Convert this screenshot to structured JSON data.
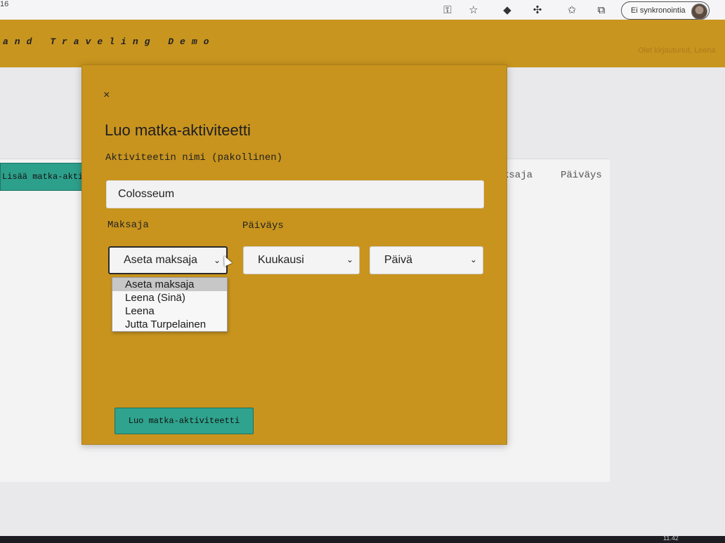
{
  "browser": {
    "tab_fragment": "16",
    "icons": [
      "key-icon",
      "favorite-add-icon",
      "extension-icon",
      "extensions-puzzle-icon",
      "favorites-icon",
      "collections-icon"
    ],
    "profile_label": "Ei synkronointia"
  },
  "header": {
    "site_title": "and Traveling Demo",
    "login_status": "Olet kirjautunut, Leena"
  },
  "background": {
    "add_button_label": "Lisää matka-akti",
    "columns": [
      "ksaja",
      "Päiväys"
    ]
  },
  "modal": {
    "close_symbol": "×",
    "title": "Luo matka-aktiviteetti",
    "name_label": "Aktiviteetin nimi (pakollinen)",
    "name_value": "Colosseum",
    "payer_label": "Maksaja",
    "date_label": "Päiväys",
    "payer_select": "Aseta maksaja",
    "month_select": "Kuukausi",
    "day_select": "Päivä",
    "payer_options": [
      "Aseta maksaja",
      "Leena (Sinä)",
      "Leena",
      "Jutta Turpelainen"
    ],
    "payer_selected_index": 0,
    "submit_label": "Luo matka-aktiviteetti"
  },
  "taskbar": {
    "clock": "11.42"
  },
  "colors": {
    "header": "#c8951f",
    "modal": "#c8941e",
    "accent_button": "#2fa38d"
  }
}
